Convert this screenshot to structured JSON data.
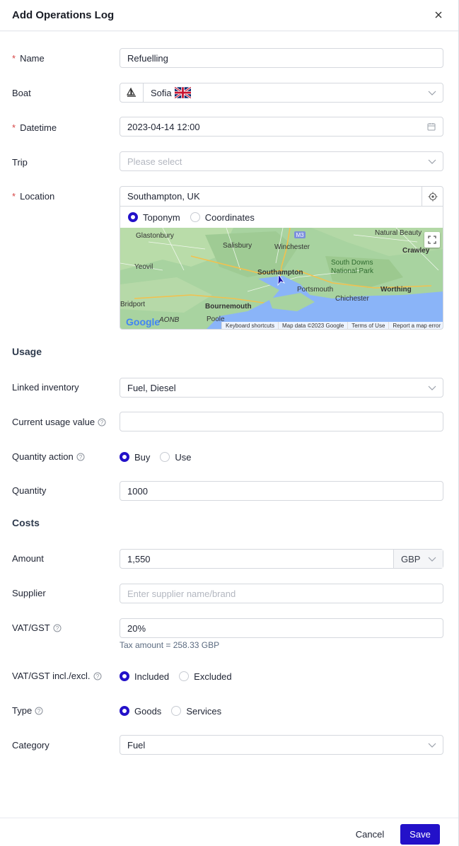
{
  "header": {
    "title": "Add Operations Log"
  },
  "fields": {
    "name": {
      "label": "Name",
      "value": "Refuelling"
    },
    "boat": {
      "label": "Boat",
      "value": "Sofia"
    },
    "datetime": {
      "label": "Datetime",
      "value": "2023-04-14 12:00"
    },
    "trip": {
      "label": "Trip",
      "placeholder": "Please select"
    },
    "location": {
      "label": "Location",
      "value": "Southampton, UK",
      "modes": [
        "Toponym",
        "Coordinates"
      ],
      "selected_mode": "Toponym"
    }
  },
  "map": {
    "places": [
      "Glastonbury",
      "Salisbury",
      "Winchester",
      "Natural Beauty",
      "Crawley",
      "Yeovil",
      "Southampton",
      "South Downs",
      "National Park",
      "Portsmouth",
      "Worthing",
      "Chichester",
      "Bournemouth",
      "Bridport",
      "Poole",
      "M3",
      "AONB"
    ],
    "attribution": [
      "Keyboard shortcuts",
      "Map data ©2023 Google",
      "Terms of Use",
      "Report a map error"
    ],
    "logo": "Google"
  },
  "usage": {
    "title": "Usage",
    "linked_inventory": {
      "label": "Linked inventory",
      "value": "Fuel, Diesel"
    },
    "current_usage_value": {
      "label": "Current usage value",
      "value": ""
    },
    "quantity_action": {
      "label": "Quantity action",
      "options": [
        "Buy",
        "Use"
      ],
      "selected": "Buy"
    },
    "quantity": {
      "label": "Quantity",
      "value": "1000"
    }
  },
  "costs": {
    "title": "Costs",
    "amount": {
      "label": "Amount",
      "value": "1,550",
      "currency": "GBP"
    },
    "supplier": {
      "label": "Supplier",
      "placeholder": "Enter supplier name/brand"
    },
    "vat": {
      "label": "VAT/GST",
      "value": "20%",
      "tax_hint": "Tax amount = 258.33 GBP"
    },
    "vat_incl": {
      "label": "VAT/GST incl./excl.",
      "options": [
        "Included",
        "Excluded"
      ],
      "selected": "Included"
    },
    "type": {
      "label": "Type",
      "options": [
        "Goods",
        "Services"
      ],
      "selected": "Goods"
    },
    "category": {
      "label": "Category",
      "value": "Fuel"
    }
  },
  "footer": {
    "cancel": "Cancel",
    "save": "Save"
  },
  "colors": {
    "primary": "#2311c9",
    "required": "#d64545"
  },
  "icons": [
    "close-icon",
    "sailboat-icon",
    "uk-flag-icon",
    "calendar-icon",
    "chevron-down-icon",
    "locate-icon",
    "fullscreen-icon",
    "help-icon"
  ]
}
